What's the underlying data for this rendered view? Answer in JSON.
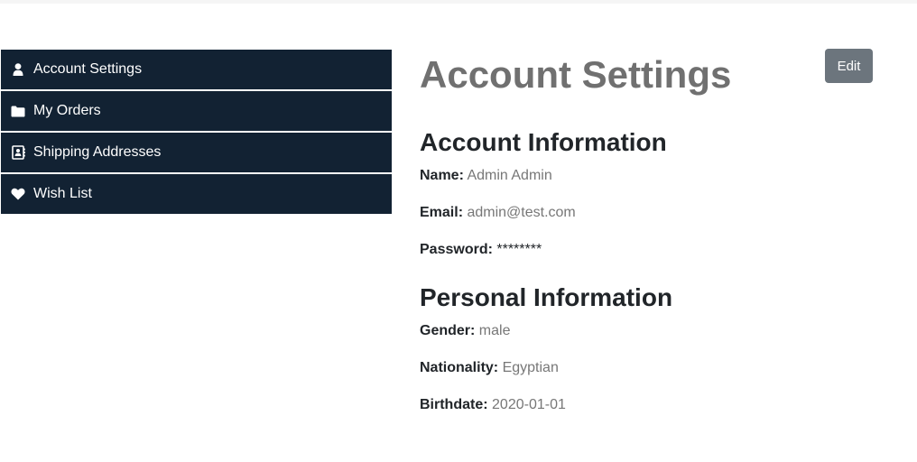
{
  "sidebar": {
    "items": [
      {
        "label": "Account Settings",
        "icon": "user-icon"
      },
      {
        "label": "My Orders",
        "icon": "folder-icon"
      },
      {
        "label": "Shipping Addresses",
        "icon": "address-book-icon"
      },
      {
        "label": "Wish List",
        "icon": "heart-icon"
      }
    ]
  },
  "main": {
    "title": "Account Settings",
    "edit_label": "Edit",
    "account_info": {
      "heading": "Account Information",
      "name_label": "Name:",
      "name_value": "Admin Admin",
      "email_label": "Email:",
      "email_value": "admin@test.com",
      "password_label": "Password:",
      "password_value": "********"
    },
    "personal_info": {
      "heading": "Personal Information",
      "gender_label": "Gender:",
      "gender_value": "male",
      "nationality_label": "Nationality:",
      "nationality_value": "Egyptian",
      "birthdate_label": "Birthdate:",
      "birthdate_value": "2020-01-01"
    }
  },
  "colors": {
    "sidebar_bg": "#122233",
    "title_gray": "#707070",
    "button_gray": "#6c757d",
    "value_gray": "#777777"
  }
}
